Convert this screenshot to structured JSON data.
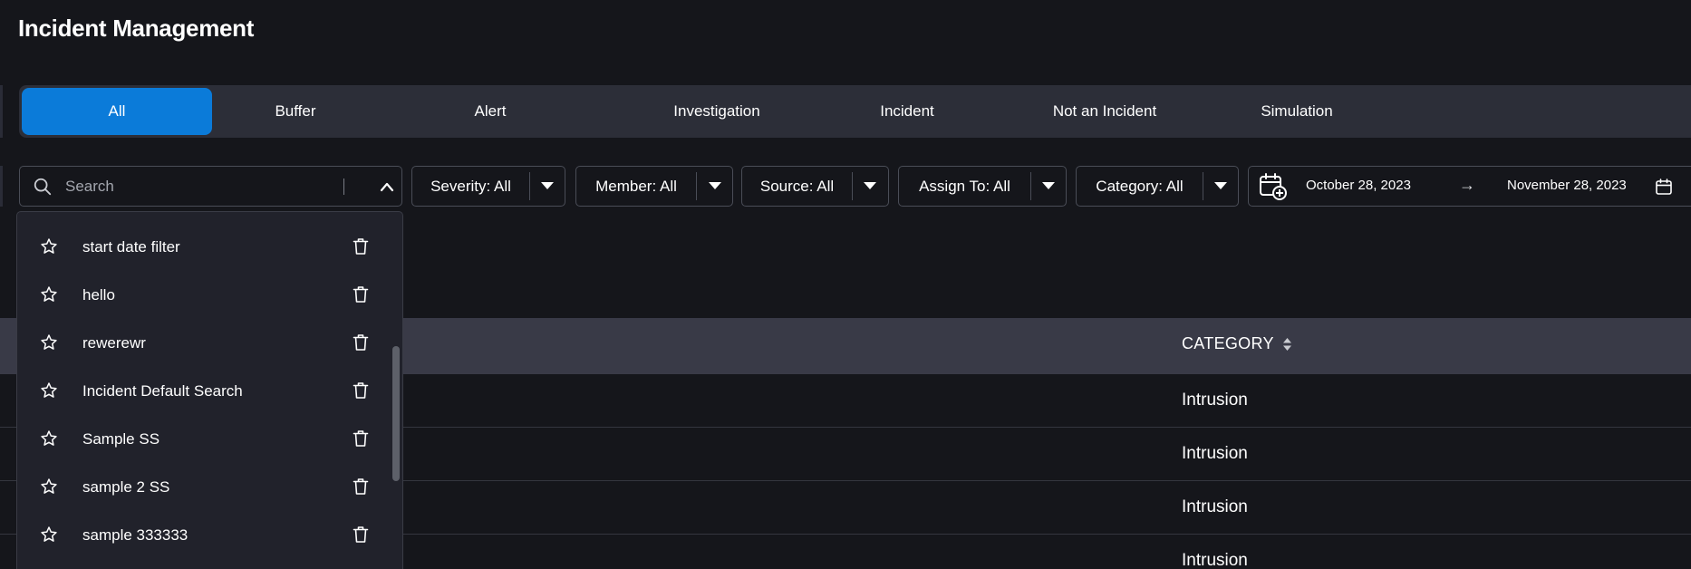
{
  "header": {
    "title": "Incident Management"
  },
  "tabs": [
    {
      "label": "All",
      "active": true
    },
    {
      "label": "Buffer",
      "active": false
    },
    {
      "label": "Alert",
      "active": false
    },
    {
      "label": "Investigation",
      "active": false
    },
    {
      "label": "Incident",
      "active": false
    },
    {
      "label": "Not an Incident",
      "active": false
    },
    {
      "label": "Simulation",
      "active": false
    }
  ],
  "search": {
    "placeholder": "Search",
    "value": "",
    "expanded": true
  },
  "filters": [
    {
      "label": "Severity: All"
    },
    {
      "label": "Member: All"
    },
    {
      "label": "Source: All"
    },
    {
      "label": "Assign To: All"
    },
    {
      "label": "Category: All"
    }
  ],
  "date_range": {
    "start": "October 28, 2023",
    "separator": "→",
    "end": "November 28, 2023"
  },
  "saved_searches": [
    {
      "label": "start date filter"
    },
    {
      "label": "hello"
    },
    {
      "label": "rewerewr"
    },
    {
      "label": "Incident Default Search"
    },
    {
      "label": "Sample SS"
    },
    {
      "label": "sample 2 SS"
    },
    {
      "label": "sample 333333"
    }
  ],
  "table": {
    "columns": [
      {
        "label": "CATEGORY"
      }
    ],
    "rows": [
      {
        "category": "Intrusion"
      },
      {
        "category": "Intrusion"
      },
      {
        "category": "Intrusion"
      },
      {
        "category": "Intrusion"
      }
    ]
  },
  "colors": {
    "background": "#15161b",
    "accent": "#0b7bd9",
    "tab_bar": "#2c2e38",
    "table_header": "#393a47",
    "dropdown_bg": "#21222b"
  }
}
